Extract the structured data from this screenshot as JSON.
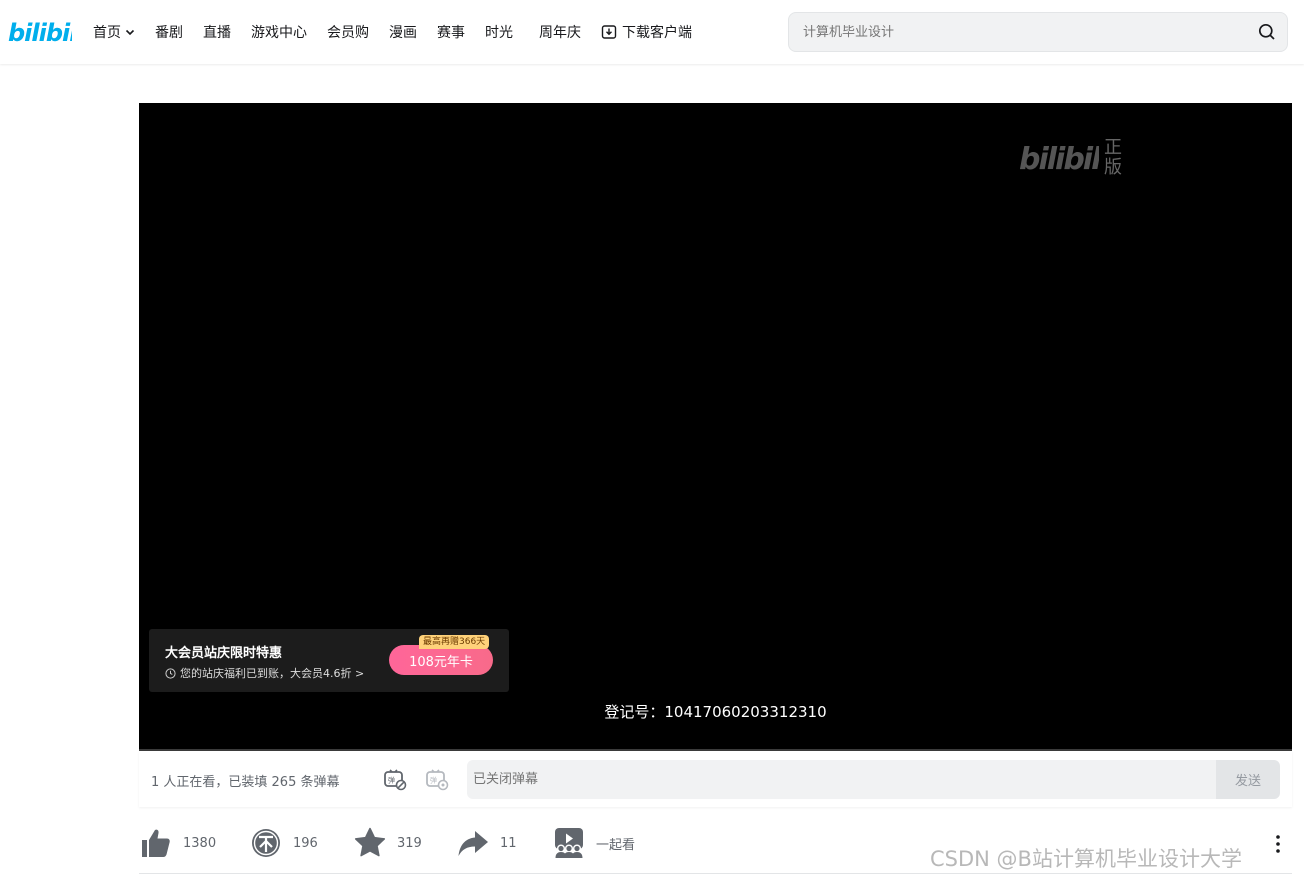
{
  "header": {
    "nav": [
      {
        "label": "首页"
      },
      {
        "label": "番剧"
      },
      {
        "label": "直播"
      },
      {
        "label": "游戏中心"
      },
      {
        "label": "会员购"
      },
      {
        "label": "漫画"
      },
      {
        "label": "赛事"
      },
      {
        "label": "时光"
      }
    ],
    "anniversary": "周年庆",
    "download": "下载客户端",
    "search_placeholder": "计算机毕业设计",
    "logo_text": "bilibili"
  },
  "player": {
    "watermark_text": "正版",
    "promo_title": "大会员站庆限时特惠",
    "promo_sub": "您的站庆福利已到账，大会员4.6折 >",
    "promo_button": "108元年卡",
    "promo_tag": "最高再赠366天",
    "registration": "登记号：10417060203312310"
  },
  "danmaku": {
    "viewers": "1 人正在看，已装填 265 条弹幕",
    "input_placeholder": "已关闭弹幕",
    "send": "发送"
  },
  "actions": {
    "like": "1380",
    "coin": "196",
    "favorite": "319",
    "share": "11",
    "watch_together": "一起看"
  },
  "overlay_watermark": "CSDN @B站计算机毕业设计大学",
  "colors": {
    "brand": "#00aeec",
    "pink": "#ff6699",
    "icon": "#61666d"
  }
}
